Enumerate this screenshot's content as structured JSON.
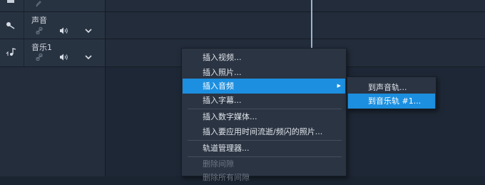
{
  "tracks": [
    {
      "name": "",
      "icon": "pencil-icon",
      "clipped": true
    },
    {
      "name": "声音",
      "icon": "microphone-icon",
      "controls": [
        "link-icon",
        "speaker-icon",
        "chevron-down-icon"
      ]
    },
    {
      "name": "音乐1",
      "icon": "music-note-icon",
      "controls": [
        "link-icon",
        "speaker-icon",
        "chevron-down-icon"
      ]
    }
  ],
  "context_menu": {
    "items": [
      {
        "label": "插入视频...",
        "state": "normal"
      },
      {
        "label": "插入照片...",
        "state": "normal"
      },
      {
        "label": "插入音频",
        "state": "active",
        "has_submenu": true
      },
      {
        "label": "插入字幕...",
        "state": "normal"
      },
      {
        "label": "插入数字媒体...",
        "state": "normal"
      },
      {
        "label": "插入要应用时间流逝/频闪的照片...",
        "state": "normal"
      },
      {
        "label": "轨道管理器...",
        "state": "normal"
      },
      {
        "label": "删除间隙",
        "state": "disabled"
      },
      {
        "label": "删除所有间隙",
        "state": "disabled"
      }
    ]
  },
  "submenu": {
    "items": [
      {
        "label": "到声音轨...",
        "state": "normal"
      },
      {
        "label": "到音乐轨 #1...",
        "state": "active"
      }
    ]
  },
  "colors": {
    "highlight": "#1c8fe0",
    "menu_bg": "#2b3442",
    "track_header_bg": "#283342",
    "timeline_bg": "#1b2431"
  }
}
